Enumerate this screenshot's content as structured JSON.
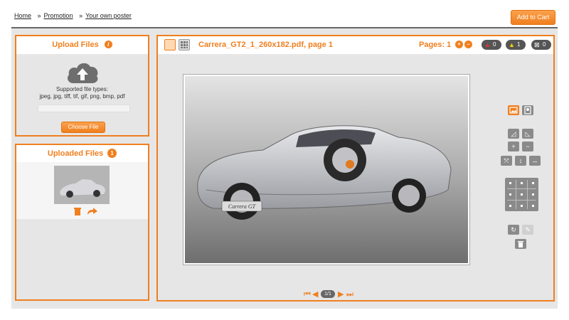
{
  "breadcrumb": {
    "items": [
      {
        "label": "Home"
      },
      {
        "label": "Promotion"
      },
      {
        "label": "Your own poster"
      }
    ],
    "separator": "»"
  },
  "header": {
    "add_to_cart_label": "Add to Cart"
  },
  "upload_panel": {
    "title": "Upload Files",
    "info_glyph": "i",
    "supported_label": "Supported file types:",
    "supported_types": "jpeg, jpg, tiff, tif, gif, png, bmp, pdf",
    "choose_file_label": "Choose File",
    "icon": "cloud-upload-icon"
  },
  "uploaded_panel": {
    "title": "Uploaded Files",
    "count": "1",
    "actions": [
      "trash-icon",
      "share-arrow-icon"
    ]
  },
  "viewer": {
    "document_title": "Carrera_GT2_1_260x182.pdf, page 1",
    "pages_label": "Pages: 1",
    "errors_count": "0",
    "warnings_count": "1",
    "info_count": "0",
    "current_page": "1/1",
    "preview_caption": "Carrera GT",
    "colors": {
      "accent": "#f07f1e",
      "tool_gray": "#8a8a8a",
      "panel_bg": "#e6e6e6"
    }
  }
}
